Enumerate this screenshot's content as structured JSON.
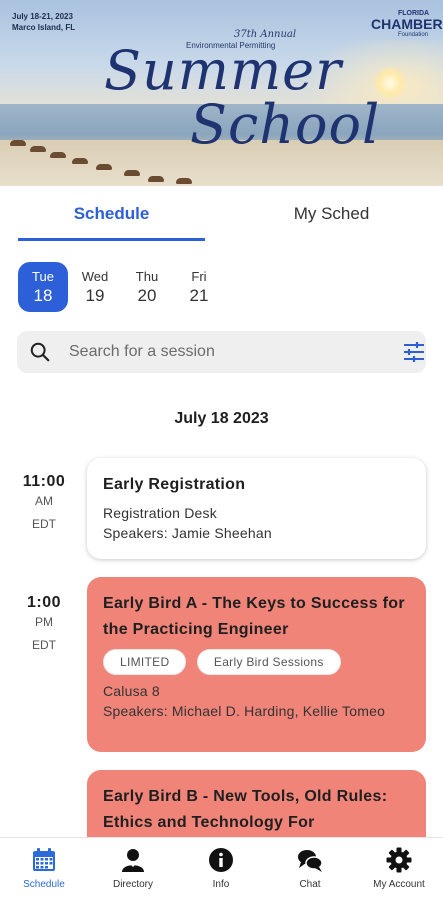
{
  "banner": {
    "date": "July 18-21, 2023",
    "location": "Marco Island, FL",
    "annual": "37th Annual",
    "event_subtitle": "Environmental Permitting",
    "title_line1": "Summer",
    "title_line2": "School",
    "logo_top": "FLORIDA",
    "logo_main": "CHAMBER",
    "logo_sub": "Foundation"
  },
  "tabs": {
    "schedule": "Schedule",
    "my_sched": "My Sched"
  },
  "days": [
    {
      "name": "Tue",
      "num": "18",
      "active": true
    },
    {
      "name": "Wed",
      "num": "19",
      "active": false
    },
    {
      "name": "Thu",
      "num": "20",
      "active": false
    },
    {
      "name": "Fri",
      "num": "21",
      "active": false
    }
  ],
  "search": {
    "placeholder": "Search for a session"
  },
  "date_heading": "July 18 2023",
  "sessions": [
    {
      "time": "11:00",
      "ampm": "AM",
      "tz": "EDT",
      "title": "Early Registration",
      "location": "Registration Desk",
      "speakers": "Speakers: Jamie Sheehan",
      "style": "white"
    },
    {
      "time": "1:00",
      "ampm": "PM",
      "tz": "EDT",
      "title": "Early Bird A - The Keys to Success for the Practicing Engineer",
      "tags": [
        "LIMITED",
        "Early Bird Sessions"
      ],
      "location": "Calusa 8",
      "speakers": "Speakers: Michael D. Harding, Kellie Tomeo",
      "style": "red",
      "color": "#f08479"
    },
    {
      "title": "Early Bird B - New Tools, Old Rules: Ethics and Technology For",
      "style": "red",
      "color": "#f08479"
    }
  ],
  "nav": [
    {
      "label": "Schedule",
      "icon": "calendar-icon",
      "active": true
    },
    {
      "label": "Directory",
      "icon": "people-icon",
      "active": false
    },
    {
      "label": "Info",
      "icon": "info-icon",
      "active": false
    },
    {
      "label": "Chat",
      "icon": "chat-icon",
      "active": false
    },
    {
      "label": "My Account",
      "icon": "gear-icon",
      "active": false
    }
  ],
  "colors": {
    "accent": "#2d5fd8",
    "session_red": "#f08479"
  }
}
